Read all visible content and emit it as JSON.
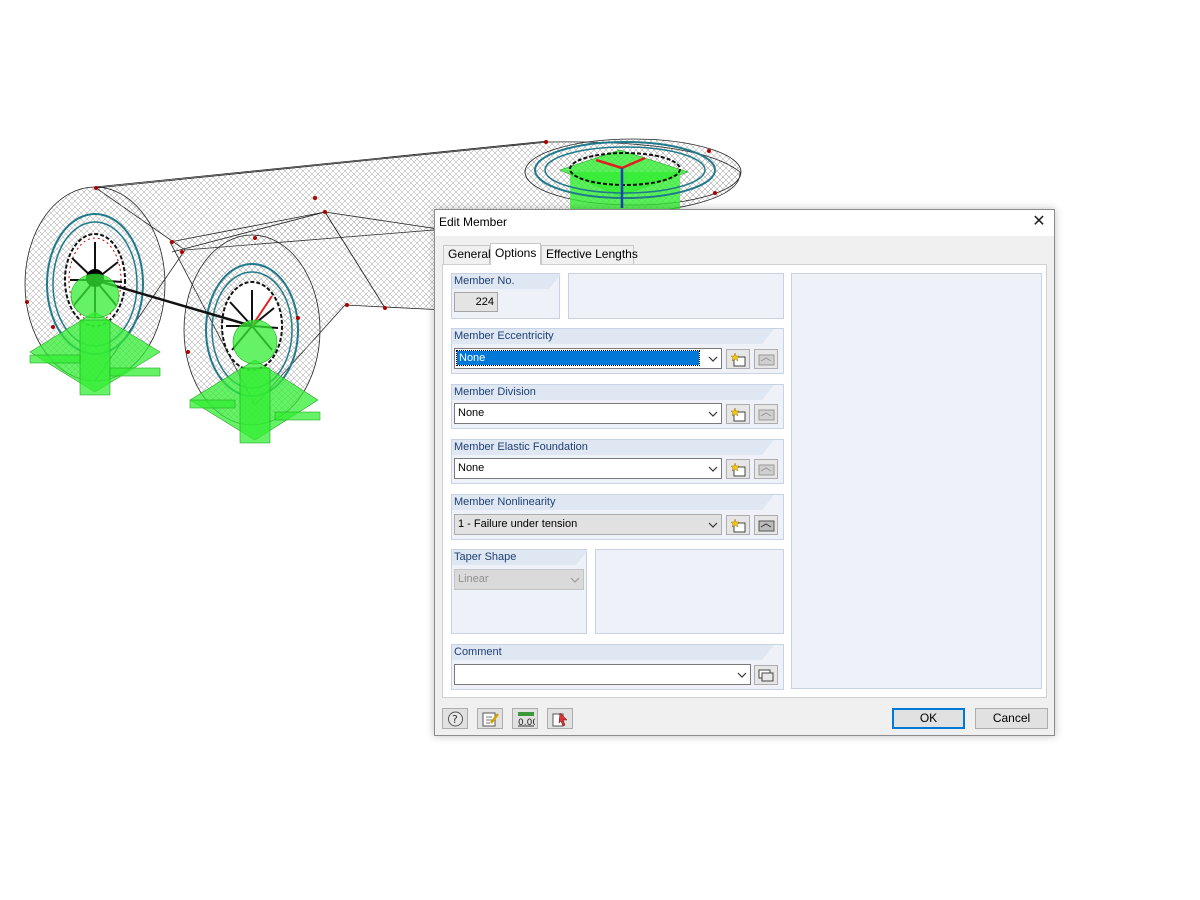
{
  "dialog": {
    "title": "Edit Member",
    "close_glyph": "✕",
    "tabs": [
      {
        "label": "General",
        "active": false
      },
      {
        "label": "Options",
        "active": true
      },
      {
        "label": "Effective Lengths",
        "active": false
      }
    ],
    "member_no": {
      "label": "Member No.",
      "value": "224"
    },
    "eccentricity": {
      "label": "Member Eccentricity",
      "value": "None"
    },
    "division": {
      "label": "Member Division",
      "value": "None"
    },
    "elastic_foundation": {
      "label": "Member Elastic Foundation",
      "value": "None"
    },
    "nonlinearity": {
      "label": "Member Nonlinearity",
      "value": "1 - Failure under tension"
    },
    "taper_shape": {
      "label": "Taper Shape",
      "value": "Linear"
    },
    "comment": {
      "label": "Comment",
      "value": ""
    },
    "footer": {
      "ok_label": "OK",
      "cancel_label": "Cancel",
      "icons": [
        "help-icon",
        "edit-icon",
        "numeric-display-icon",
        "selection-icon"
      ]
    },
    "icons": {
      "new": "new-item-icon",
      "edit": "edit-item-icon",
      "comment_library": "comment-library-icon"
    }
  },
  "model_view": {
    "colors": {
      "support": "#33ee33",
      "wireframe": "#555555",
      "ring": "#1f7a8c",
      "axis_x": "#e02020",
      "axis_z": "#1f3fbf",
      "node": "#b00000"
    }
  }
}
